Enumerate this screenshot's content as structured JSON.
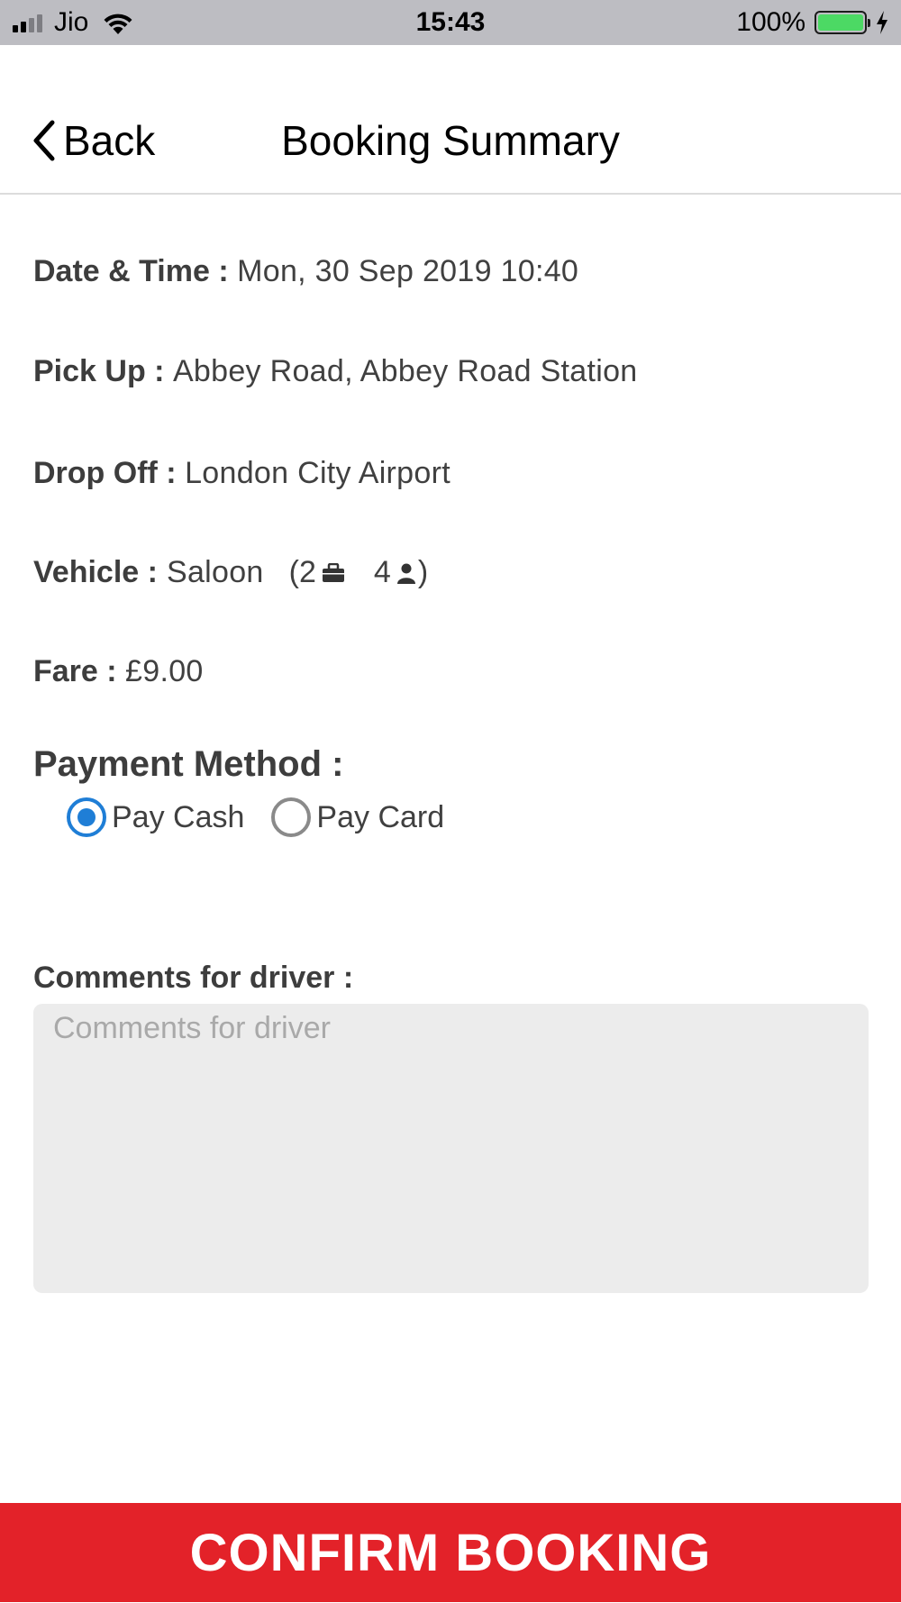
{
  "status_bar": {
    "carrier": "Jio",
    "time": "15:43",
    "battery_percent": "100%",
    "battery_level": 1.0,
    "battery_color": "#4cd964",
    "signal_bars_filled": 2,
    "signal_bars_total": 4,
    "icons": [
      "signal-icon",
      "wifi-icon",
      "battery-icon",
      "charging-icon"
    ]
  },
  "nav": {
    "back_label": "Back",
    "back_icon": "chevron-left-icon",
    "title": "Booking Summary"
  },
  "summary": {
    "date_time": {
      "label": "Date & Time :",
      "value": "Mon, 30 Sep 2019 10:40"
    },
    "pick_up": {
      "label": "Pick Up :",
      "value": "Abbey Road, Abbey Road Station"
    },
    "drop_off": {
      "label": "Drop Off :",
      "value": "London City Airport"
    },
    "vehicle": {
      "label": "Vehicle :",
      "value": "Saloon",
      "open_paren": "(",
      "luggage_count": "2",
      "luggage_icon": "briefcase-icon",
      "passenger_count": "4",
      "passenger_icon": "person-icon",
      "close_paren": ")"
    },
    "fare": {
      "label": "Fare :",
      "value": "£9.00"
    }
  },
  "payment": {
    "title": "Payment Method :",
    "options": [
      {
        "label": "Pay Cash",
        "selected": true
      },
      {
        "label": "Pay Card",
        "selected": false
      }
    ],
    "accent_color": "#1f7ed6"
  },
  "comments": {
    "label": "Comments for driver :",
    "placeholder": "Comments for driver",
    "value": ""
  },
  "confirm": {
    "label": "CONFIRM BOOKING",
    "color": "#e32229"
  }
}
